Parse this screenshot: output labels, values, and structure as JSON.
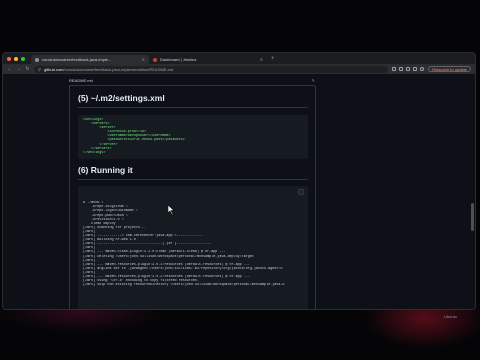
{
  "browser": {
    "tabs": [
      {
        "label": "conclusioncareerfeedback-java-imple..."
      },
      {
        "label": "Dashboard | Jenkins"
      }
    ],
    "new_tab": "+",
    "url_host": "github.com",
    "url_path": "/conclusioncareerfeedback-java-implementation/README.md",
    "relaunch": "Relaunch to update"
  },
  "file": {
    "name": "README.md",
    "edit_icon": "pencil-icon"
  },
  "sections": [
    {
      "heading": "(5) ~/.m2/settings.xml"
    },
    {
      "heading": "(6) Running it"
    }
  ],
  "settings_xml": [
    "<settings>",
    "    <servers>",
    "        <server>",
    "            <id>nexus-prod</id>",
    "            <username>devopsuser</username>",
    "            <password>s3cr3t-nexus-pass</password>",
    "        </server>",
    "    </servers>",
    "</settings>"
  ],
  "run_log": [
    "$ ./mvnw \\",
    "    -Drepo.id=github \\",
    "    -Drepo.login=USERNAME \\",
    "    -Drepo.pwd=TOKEN \\",
    "    -Drevision=1.0 \\",
    "    clean deploy",
    "[INFO] Scanning for projects...",
    "[INFO]",
    "[INFO] ------------< com.carecenter:java-app >-------------",
    "[INFO] Building hr-web 1.0",
    "[INFO] --------------------------------[ jar ]-----------------",
    "[INFO]",
    "[INFO] --- maven-clean-plugin:3.1.0:clean (default-clean) @ hr-app ---",
    "[INFO] Deleting /Users/john.sullivan/workspace/personal/mvnsample-java-deploy/target",
    "[INFO]",
    "[INFO] --- maven-resources-plugin:3.0.2:resources (default-resources) @ hr-app ---",
    "[INFO] argLine set to -javaagent:/Users/john.sullivan/.m2/repository/org/jacoco/org.jacoco.agent/0",
    "[INFO]",
    "[INFO] --- maven-resources-plugin:3.0.2:resources (default-resources) @ hr-app ---",
    "[INFO] Using 'UTF-8' encoding to copy filtered resources.",
    "[INFO] skip non existing resourceDirectory /Users/john.sullivan/workspace/personal/mvnsample-java-d"
  ],
  "taskbar": {
    "label": "Ubuntu"
  }
}
